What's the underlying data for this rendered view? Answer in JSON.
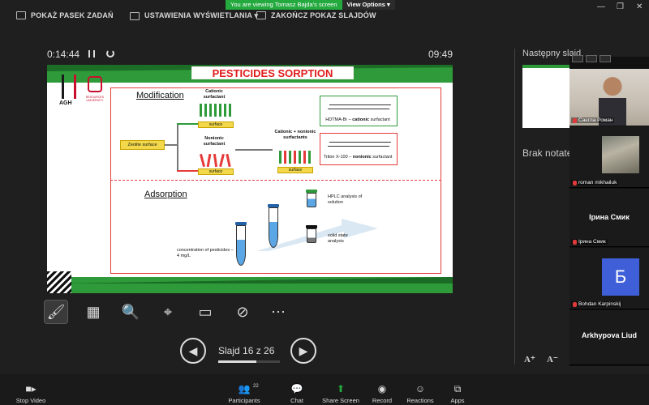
{
  "topbar": {
    "taskbar_label": "POKAŻ PASEK ZADAŃ",
    "display_settings_label": "USTAWIENIA WYŚWIETLANIA ▾",
    "end_slideshow_label": "ZAKOŃCZ POKAZ SLAJDÓW",
    "share_banner": "You are viewing Tomasz Bajda's screen",
    "view_options": "View Options ▾"
  },
  "presenter": {
    "timer": "0:14:44",
    "clock": "09:49",
    "slide_counter": "Slajd 16 z 26",
    "progress_fraction": 0.615,
    "next_slide_label": "Następny slajd",
    "notes_label": "Brak notatek"
  },
  "slide": {
    "title": "PESTICIDES SORPTION",
    "logo_agh": "AGH",
    "logo_uni": "RESOURCES UNIVERSITY",
    "modification": "Modification",
    "adsorption": "Adsorption",
    "cationic": "Cationic surfactant",
    "nonionic": "Nonionic surfactant",
    "cationic_nonionic": "Cationic + nonionic surfactants",
    "zeolite_surface": "Zeolite surface",
    "surface": "surface",
    "hdtma_prefix": "HDTMA-Br – ",
    "hdtma_bold": "cationic",
    "hdtma_suffix": " surfactant",
    "triton_prefix": "Triton X-100 – ",
    "triton_bold": "nonionic",
    "triton_suffix": " surfactant",
    "concentration": "concentration of pesticides – 4 mg/L",
    "hplc": "HPLC analysis of solution",
    "solid_state": "solid state analysis"
  },
  "participants": [
    {
      "name": "Саєгла Роман"
    },
    {
      "name": "roman mikhailuk"
    },
    {
      "name": "Ірина Смик",
      "display": "Ірина Смик"
    },
    {
      "name": "Bohdan Karpinskij",
      "initial": "Б"
    },
    {
      "display": "Arkhypova Liud"
    }
  ],
  "font_controls": [
    "A⁺",
    "A⁻"
  ],
  "toolbar": {
    "stop_video": "Stop Video",
    "participants": "Participants",
    "participants_count": "22",
    "chat": "Chat",
    "share_screen": "Share Screen",
    "record": "Record",
    "reactions": "Reactions",
    "apps": "Apps"
  },
  "colors": {
    "slide_green": "#2e9a3a",
    "slide_red": "#e01b1b",
    "share_green": "#23a93e",
    "avatar_blue": "#3f5fd8"
  }
}
